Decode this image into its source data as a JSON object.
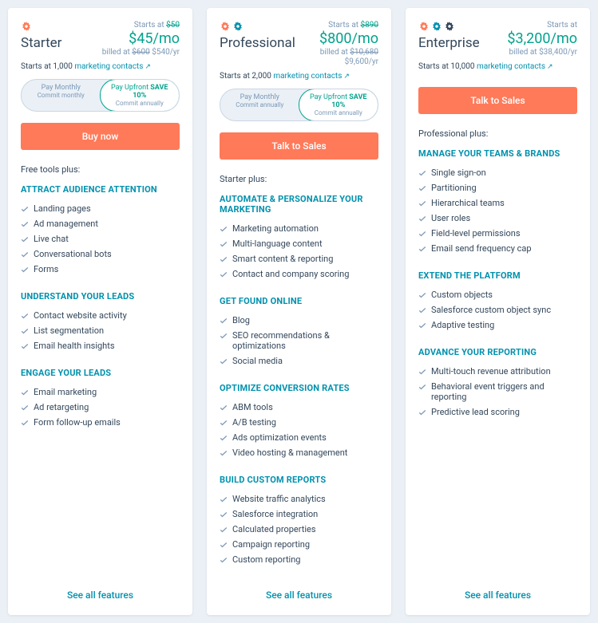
{
  "common": {
    "starts_at_label": "Starts at",
    "see_all": "See all features",
    "marketing_contacts": "marketing contacts",
    "ext_icon": "↗"
  },
  "plans": [
    {
      "tier": "Starter",
      "sprockets": 1,
      "price_strike": "$50",
      "price": "$45/mo",
      "billed_prefix": "billed at",
      "billed_strike": "$600",
      "billed": "$540/yr",
      "contacts_prefix": "Starts at 1,000",
      "toggle": {
        "left_main": "Pay Monthly",
        "left_sub": "Commit monthly",
        "right_main": "Pay Upfront",
        "right_save": "SAVE 10%",
        "right_sub": "Commit annually"
      },
      "cta": "Buy now",
      "plus": "Free tools plus:",
      "groups": [
        {
          "title": "ATTRACT AUDIENCE ATTENTION",
          "features": [
            "Landing pages",
            "Ad management",
            "Live chat",
            "Conversational bots",
            "Forms"
          ]
        },
        {
          "title": "UNDERSTAND YOUR LEADS",
          "features": [
            "Contact website activity",
            "List segmentation",
            "Email health insights"
          ]
        },
        {
          "title": "ENGAGE YOUR LEADS",
          "features": [
            "Email marketing",
            "Ad retargeting",
            "Form follow-up emails"
          ]
        }
      ]
    },
    {
      "tier": "Professional",
      "sprockets": 2,
      "price_strike": "$890",
      "price": "$800/mo",
      "billed_prefix": "billed at",
      "billed_strike": "$10,680",
      "billed": "$9,600/yr",
      "contacts_prefix": "Starts at 2,000",
      "toggle": {
        "left_main": "Pay Monthly",
        "left_sub": "Commit annually",
        "right_main": "Pay Upfront",
        "right_save": "SAVE 10%",
        "right_sub": "Commit annually"
      },
      "cta": "Talk to Sales",
      "plus": "Starter plus:",
      "groups": [
        {
          "title": "AUTOMATE & PERSONALIZE YOUR MARKETING",
          "features": [
            "Marketing automation",
            "Multi-language content",
            "Smart content & reporting",
            "Contact and company scoring"
          ]
        },
        {
          "title": "GET FOUND ONLINE",
          "features": [
            "Blog",
            "SEO recommendations & optimizations",
            "Social media"
          ]
        },
        {
          "title": "OPTIMIZE CONVERSION RATES",
          "features": [
            "ABM tools",
            "A/B testing",
            "Ads optimization events",
            "Video hosting & management"
          ]
        },
        {
          "title": "BUILD CUSTOM REPORTS",
          "features": [
            "Website traffic analytics",
            "Salesforce integration",
            "Calculated properties",
            "Campaign reporting",
            "Custom reporting"
          ]
        }
      ]
    },
    {
      "tier": "Enterprise",
      "sprockets": 3,
      "price_strike": "",
      "price": "$3,200/mo",
      "billed_prefix": "billed at",
      "billed_strike": "",
      "billed": "$38,400/yr",
      "contacts_prefix": "Starts at 10,000",
      "toggle": null,
      "cta": "Talk to Sales",
      "plus": "Professional plus:",
      "groups": [
        {
          "title": "MANAGE YOUR TEAMS & BRANDS",
          "features": [
            "Single sign-on",
            "Partitioning",
            "Hierarchical teams",
            "User roles",
            "Field-level permissions",
            "Email send frequency cap"
          ]
        },
        {
          "title": "EXTEND THE PLATFORM",
          "features": [
            "Custom objects",
            "Salesforce custom object sync",
            "Adaptive testing"
          ]
        },
        {
          "title": "ADVANCE YOUR REPORTING",
          "features": [
            "Multi-touch revenue attribution",
            "Behavioral event triggers and reporting",
            "Predictive lead scoring"
          ]
        }
      ]
    }
  ]
}
